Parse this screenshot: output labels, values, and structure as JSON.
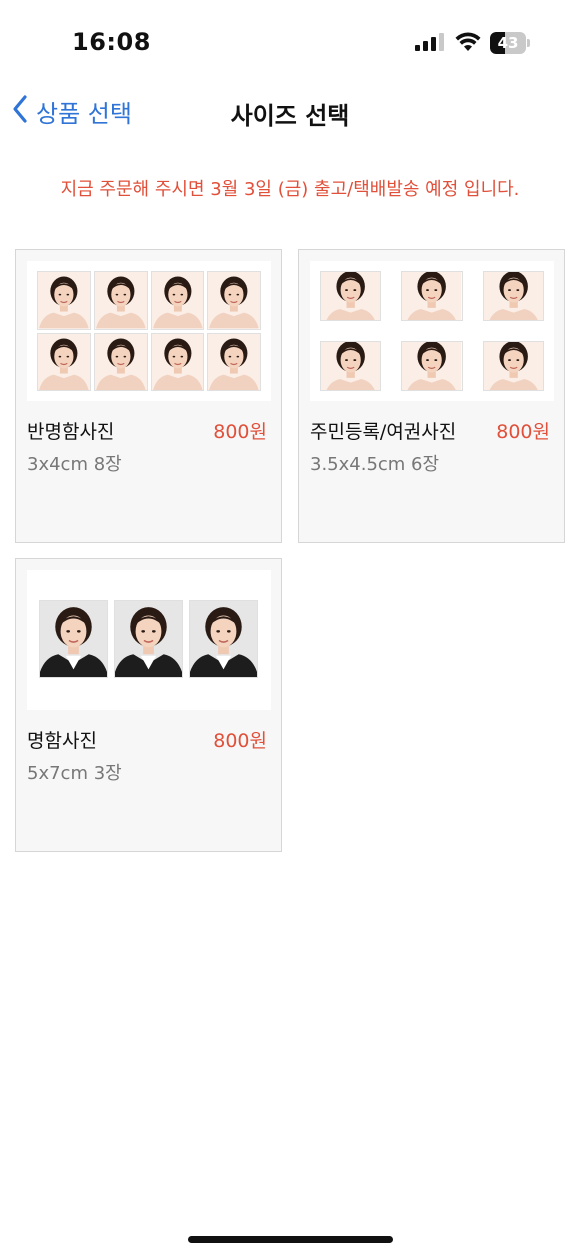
{
  "status_bar": {
    "time": "16:08",
    "battery_level": "43",
    "battery_fraction": 0.43,
    "icons": [
      "signal-icon",
      "wifi-icon",
      "battery-icon"
    ]
  },
  "nav": {
    "back_label": "상품 선택",
    "back_icon": "chevron-left-icon",
    "title": "사이즈 선택",
    "accent_color": "#2f74d6"
  },
  "notice": {
    "text": "지금 주문해 주시면 3월 3일 (금) 출고/택배발송 예정 입니다.",
    "color": "#e0503a"
  },
  "products": [
    {
      "name": "반명함사진",
      "price": "800원",
      "spec": "3x4cm 8장"
    },
    {
      "name": "주민등록/여권사진",
      "price": "800원",
      "spec": "3.5x4.5cm 6장"
    },
    {
      "name": "명함사진",
      "price": "800원",
      "spec": "5x7cm 3장"
    }
  ]
}
